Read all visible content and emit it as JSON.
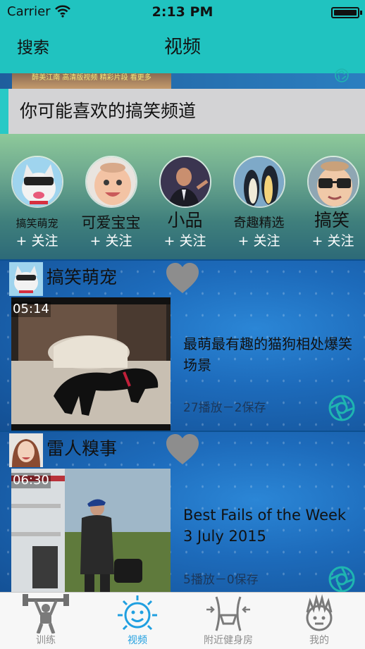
{
  "status_bar": {
    "carrier": "Carrier",
    "time": "2:13 PM"
  },
  "nav": {
    "left_button": "搜索",
    "title": "视频"
  },
  "previous_card": {
    "thumbnail_caption": "醉美江南 高清版视频 精彩片段 看更多"
  },
  "section": {
    "title": "你可能喜欢的搞笑频道"
  },
  "channels": [
    {
      "name": "搞笑萌宠",
      "follow": "+ 关注",
      "avatar_icon": "cat-avatar"
    },
    {
      "name": "可爱宝宝",
      "follow": "+ 关注",
      "avatar_icon": "baby-avatar"
    },
    {
      "name": "小品",
      "follow": "+ 关注",
      "avatar_icon": "comedian-avatar"
    },
    {
      "name": "奇趣精选",
      "follow": "+ 关注",
      "avatar_icon": "penguin-avatar"
    },
    {
      "name": "搞笑",
      "follow": "+ 关注",
      "avatar_icon": "boy-glasses-avatar"
    }
  ],
  "videos": [
    {
      "channel": "搞笑萌宠",
      "duration": "05:14",
      "title": "最萌最有趣的猫狗相处爆笑场景",
      "stats": "27播放－2保存",
      "thumb_icon": "dog-on-bed-thumbnail",
      "favorited": false
    },
    {
      "channel": "雷人糗事",
      "duration": "06:30",
      "title": "Best Fails of the Week 3 July 2015",
      "stats": "5播放－0保存",
      "thumb_icon": "backyard-fail-thumbnail",
      "favorited": false
    }
  ],
  "tabs": [
    {
      "label": "训练",
      "icon": "weightlifter-icon",
      "active": false
    },
    {
      "label": "视频",
      "icon": "smiley-sun-icon",
      "active": true
    },
    {
      "label": "附近健身房",
      "icon": "fitness-waist-icon",
      "active": false
    },
    {
      "label": "我的",
      "icon": "spiky-hair-face-icon",
      "active": false
    }
  ],
  "colors": {
    "nav_bar": "#20c3c0",
    "section_accent": "#28c9c6",
    "tab_active": "#1f9fe0",
    "tab_inactive": "#8e8e8e",
    "card_background": "#1d6bbb",
    "share_icon": "#1fb5b0"
  }
}
